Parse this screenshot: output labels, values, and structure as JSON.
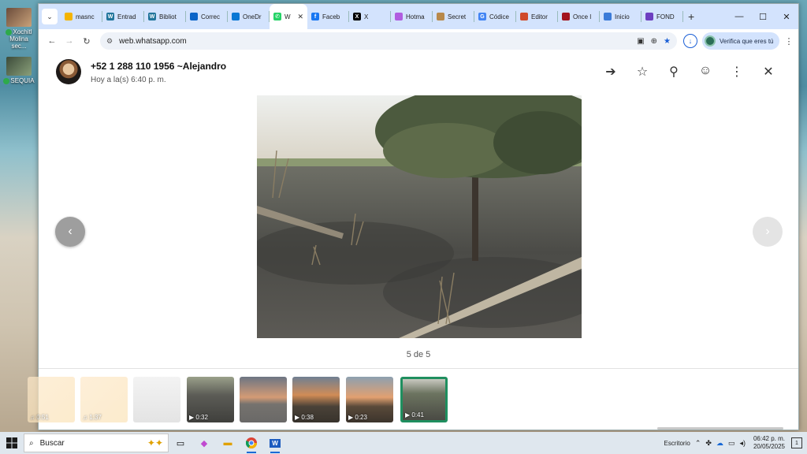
{
  "desktop": {
    "icons": [
      {
        "label": "Xochitl Molina sec..."
      },
      {
        "label": "SEQUIA"
      }
    ]
  },
  "browser": {
    "tabs": [
      {
        "label": "masnc",
        "icon": "drive-icon",
        "color": "#f4b400"
      },
      {
        "label": "Entrad",
        "icon": "wordpress-icon",
        "color": "#21759b"
      },
      {
        "label": "Bibliot",
        "icon": "wordpress-icon",
        "color": "#21759b"
      },
      {
        "label": "Correc",
        "icon": "outlook-icon",
        "color": "#0a64c8"
      },
      {
        "label": "OneDr",
        "icon": "onedrive-icon",
        "color": "#0a78d4"
      },
      {
        "label": "W",
        "icon": "whatsapp-icon",
        "color": "#25d366",
        "active": true
      },
      {
        "label": "Faceb",
        "icon": "facebook-icon",
        "color": "#1877f2"
      },
      {
        "label": "X",
        "icon": "x-icon",
        "color": "#000000"
      },
      {
        "label": "Hotma",
        "icon": "copilot-icon",
        "color": "#b05de0"
      },
      {
        "label": "Secret",
        "icon": "seal-icon",
        "color": "#b8894a"
      },
      {
        "label": "Códice",
        "icon": "google-icon",
        "color": "#4285f4"
      },
      {
        "label": "Editor",
        "icon": "editor-icon",
        "color": "#d04a2a"
      },
      {
        "label": "Once l",
        "icon": "opera-icon",
        "color": "#a3141e"
      },
      {
        "label": "Inicio",
        "icon": "globe-icon",
        "color": "#3b7bd8"
      },
      {
        "label": "FOND",
        "icon": "form-icon",
        "color": "#6d3fc0"
      }
    ],
    "url": "web.whatsapp.com",
    "profile_label": "Verifica que eres tú"
  },
  "viewer": {
    "sender": "+52 1 288 110 1956 ~Alejandro",
    "time": "Hoy a la(s) 6:40 p. m.",
    "counter": "5 de 5",
    "thumbnails": [
      {
        "caption": "0:51",
        "kind": "audio"
      },
      {
        "caption": "1:37",
        "kind": "audio"
      },
      {
        "caption": "",
        "kind": "image"
      },
      {
        "caption": "0:32",
        "kind": "video"
      },
      {
        "caption": "",
        "kind": "image"
      },
      {
        "caption": "0:38",
        "kind": "video"
      },
      {
        "caption": "0:23",
        "kind": "video"
      },
      {
        "caption": "0:41",
        "kind": "video",
        "active": true
      }
    ]
  },
  "taskbar": {
    "search_placeholder": "Buscar",
    "desktop_label": "Escritorio",
    "time": "06:42 p. m.",
    "date": "20/05/2025",
    "notifications": "1"
  },
  "colors": {
    "accent": "#1a5fd6",
    "whatsapp_green": "#1f8f5f",
    "tabstrip": "#d3e3fd"
  }
}
